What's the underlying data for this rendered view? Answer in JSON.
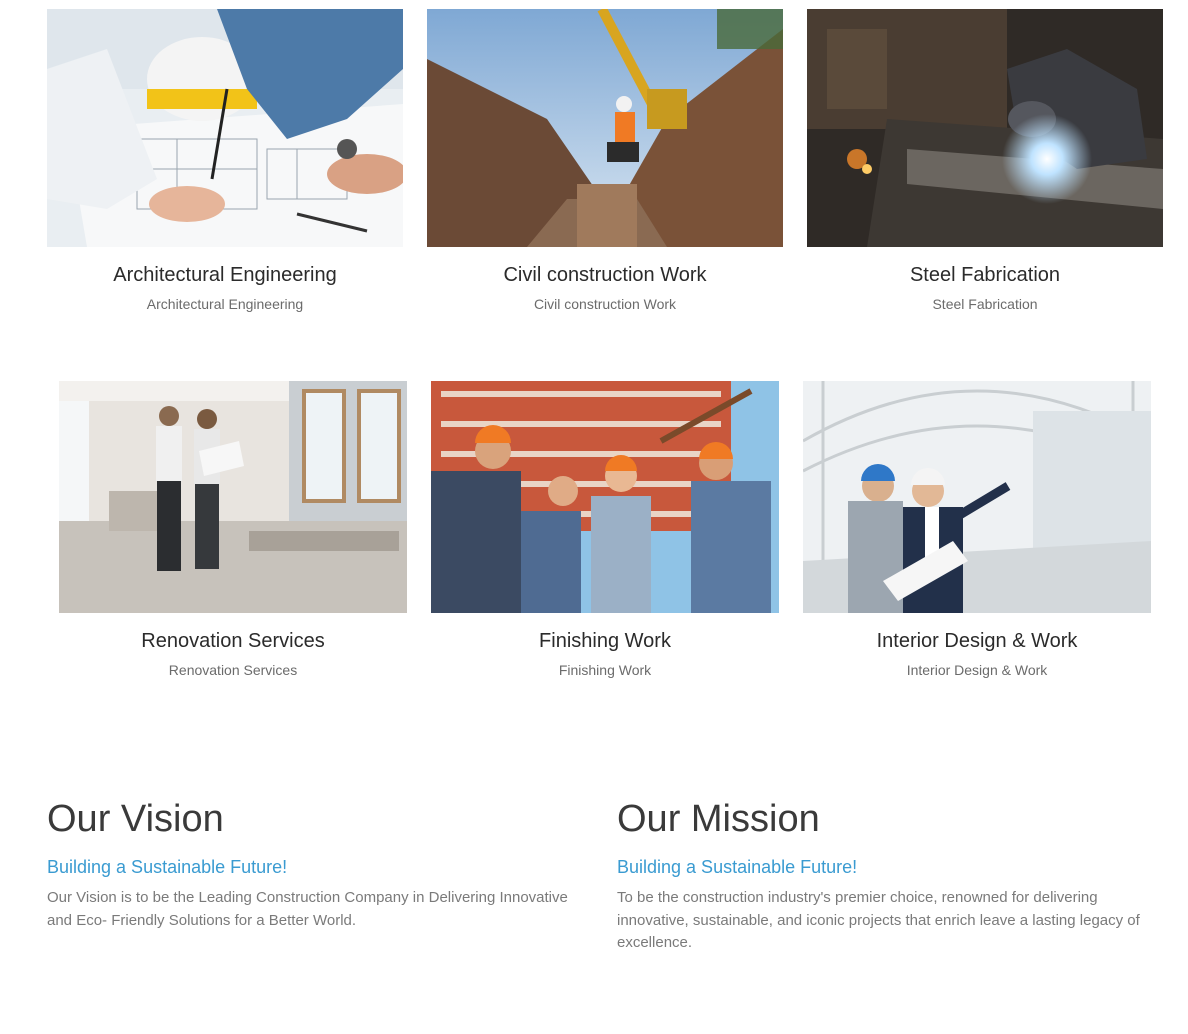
{
  "services": [
    {
      "title": "Architectural Engineering",
      "subtitle": "Architectural Engineering",
      "image": "architect-blueprint-photo"
    },
    {
      "title": "Civil construction Work",
      "subtitle": "Civil construction Work",
      "image": "trench-excavator-photo"
    },
    {
      "title": "Steel Fabrication",
      "subtitle": "Steel Fabrication",
      "image": "welder-sparks-photo"
    },
    {
      "title": "Renovation Services",
      "subtitle": "Renovation Services",
      "image": "renovation-workers-photo"
    },
    {
      "title": "Finishing Work",
      "subtitle": "Finishing Work",
      "image": "cheering-workers-photo"
    },
    {
      "title": "Interior Design & Work",
      "subtitle": "Interior Design & Work",
      "image": "engineers-walkway-photo"
    }
  ],
  "vision": {
    "heading": "Our Vision",
    "tagline": "Building a Sustainable Future!",
    "text": "Our Vision is to be the Leading Construction Company in Delivering Innovative and Eco- Friendly Solutions for a Better World."
  },
  "mission": {
    "heading": "Our Mission",
    "tagline": "Building a Sustainable Future!",
    "text": "To be the construction industry's premier choice, renowned for delivering innovative, sustainable, and iconic projects that enrich leave a lasting legacy of excellence."
  },
  "colors": {
    "accent": "#3a9bd1",
    "heading": "#3a3a3a",
    "body": "#7a7a7a"
  }
}
